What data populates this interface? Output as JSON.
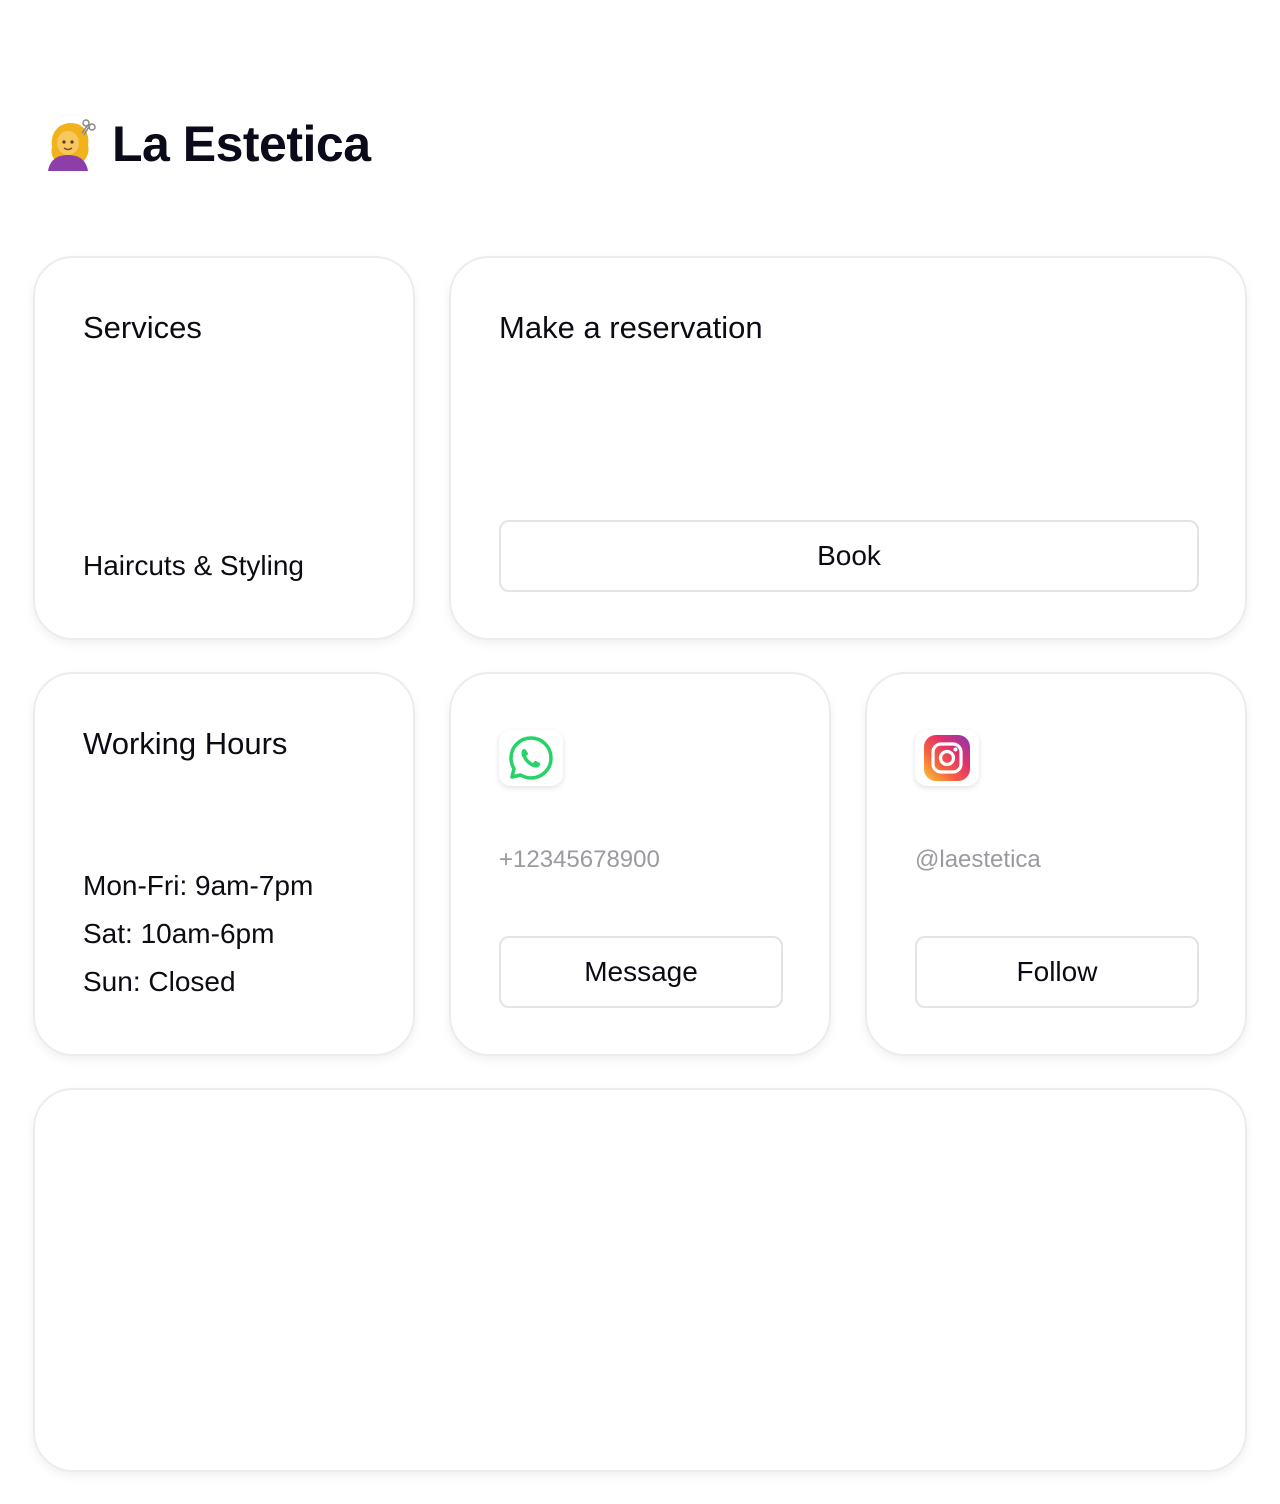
{
  "header": {
    "logo_icon": "hairdresser-emoji-icon",
    "brand": "La Estetica"
  },
  "services": {
    "title": "Services",
    "item": "Haircuts & Styling"
  },
  "reservation": {
    "title": "Make a reservation",
    "button_label": "Book"
  },
  "hours": {
    "title": "Working Hours",
    "lines": [
      "Mon-Fri: 9am-7pm",
      "Sat: 10am-6pm",
      "Sun: Closed"
    ]
  },
  "whatsapp": {
    "icon": "whatsapp-icon",
    "phone": "+12345678900",
    "button_label": "Message",
    "color": "#25D366"
  },
  "instagram": {
    "icon": "instagram-icon",
    "handle": "@laestetica",
    "button_label": "Follow"
  }
}
